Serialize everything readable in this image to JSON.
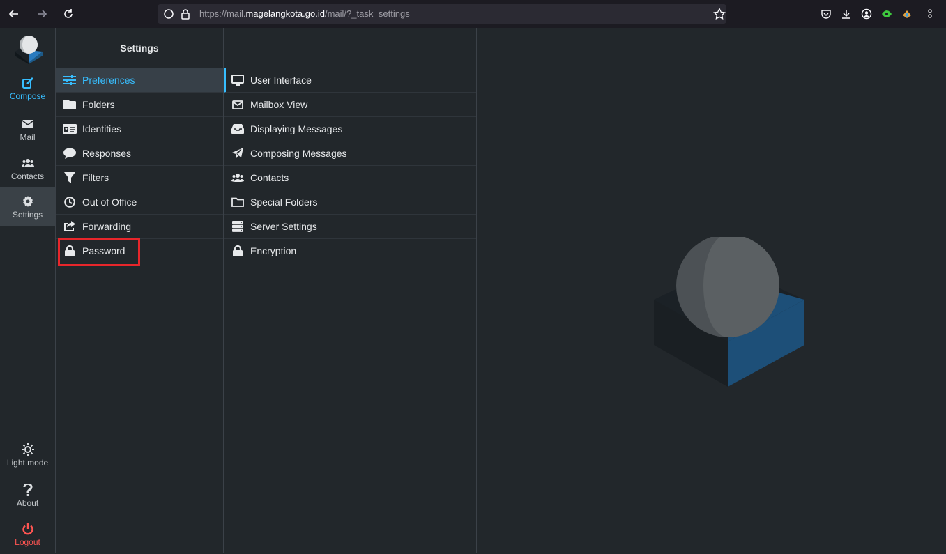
{
  "browser": {
    "url_prefix": "https://mail.",
    "url_host": "magelangkota.go.id",
    "url_path": "/mail/?_task=settings"
  },
  "taskbar": {
    "compose": "Compose",
    "mail": "Mail",
    "contacts": "Contacts",
    "settings": "Settings",
    "light_mode": "Light mode",
    "about": "About",
    "logout": "Logout"
  },
  "settings_header": "Settings",
  "settings_menu": [
    {
      "label": "Preferences",
      "icon": "sliders-icon"
    },
    {
      "label": "Folders",
      "icon": "folder-icon"
    },
    {
      "label": "Identities",
      "icon": "id-card-icon"
    },
    {
      "label": "Responses",
      "icon": "comment-icon"
    },
    {
      "label": "Filters",
      "icon": "filter-icon"
    },
    {
      "label": "Out of Office",
      "icon": "clock-icon"
    },
    {
      "label": "Forwarding",
      "icon": "share-icon"
    },
    {
      "label": "Password",
      "icon": "lock-icon"
    }
  ],
  "preferences_menu": [
    {
      "label": "User Interface",
      "icon": "monitor-icon"
    },
    {
      "label": "Mailbox View",
      "icon": "envelope-icon"
    },
    {
      "label": "Displaying Messages",
      "icon": "inbox-icon"
    },
    {
      "label": "Composing Messages",
      "icon": "paper-plane-icon"
    },
    {
      "label": "Contacts",
      "icon": "users-icon"
    },
    {
      "label": "Special Folders",
      "icon": "folder-outline-icon"
    },
    {
      "label": "Server Settings",
      "icon": "server-icon"
    },
    {
      "label": "Encryption",
      "icon": "lock-icon"
    }
  ],
  "colors": {
    "accent": "#37beff",
    "logout": "#ff5552",
    "highlight": "#e8262b",
    "background": "#22272b"
  }
}
